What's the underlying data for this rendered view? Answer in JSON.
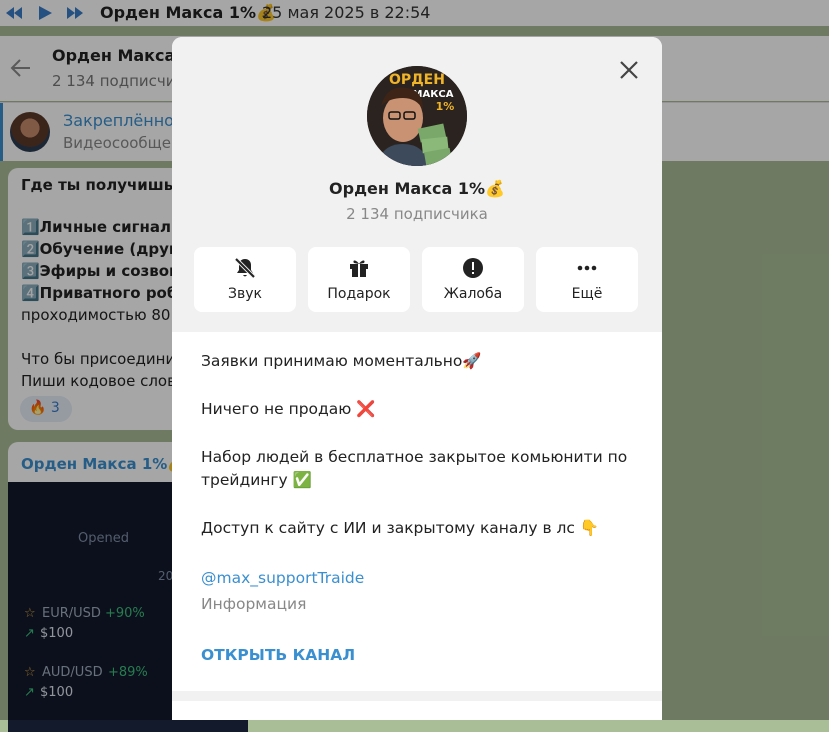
{
  "player": {
    "title": "Орден Макса 1%💰",
    "date": "25 мая 2025 в 22:54"
  },
  "header": {
    "title": "Орден Макса 1",
    "subtitle": "2 134 подписчи"
  },
  "pinned": {
    "title": "Закреплённое",
    "subtitle": "Видеосообще"
  },
  "message1": {
    "lines": [
      "Где ты получишь:",
      "1️⃣Личные сигнал",
      "2️⃣Обучение (друг",
      "3️⃣Эфиры и созвон",
      "4️⃣Приватного роб",
      "проходимостью 80",
      "Что бы присоедини",
      "Пиши кодовое слов"
    ],
    "reaction": "🔥 3"
  },
  "message2": {
    "title": "Орден Макса 1%💰",
    "label_opened": "Opened",
    "date_partial": "20",
    "trades": [
      {
        "pair": "EUR/USD",
        "pct": "+90%",
        "amount": "$100"
      },
      {
        "pair": "AUD/USD",
        "pct": "+89%",
        "amount": "$100"
      }
    ]
  },
  "modal": {
    "avatar_text1": "ОРДЕН",
    "avatar_text2": "МАКСА",
    "avatar_text3": "1%",
    "channel_name": "Орден Макса 1%💰",
    "subscribers": "2 134 подписчика",
    "actions": [
      {
        "label": "Звук",
        "icon": "bell-off-icon"
      },
      {
        "label": "Подарок",
        "icon": "gift-icon"
      },
      {
        "label": "Жалоба",
        "icon": "report-icon"
      },
      {
        "label": "Ещё",
        "icon": "more-icon"
      }
    ],
    "description": [
      "Заявки принимаю моментально🚀",
      "Ничего не продаю ❌",
      "Набор людей в бесплатное закрытое комьюнити по трейдингу ✅",
      "Доступ к сайту с ИИ и закрытому каналу в лс 👇"
    ],
    "link": "@max_supportTraide",
    "info_label": "Информация",
    "open_button": "ОТКРЫТЬ КАНАЛ"
  },
  "colors": {
    "accent": "#3a8fd0",
    "chat_bg": "#a9be97",
    "modal_top_bg": "#f1f1f1"
  }
}
